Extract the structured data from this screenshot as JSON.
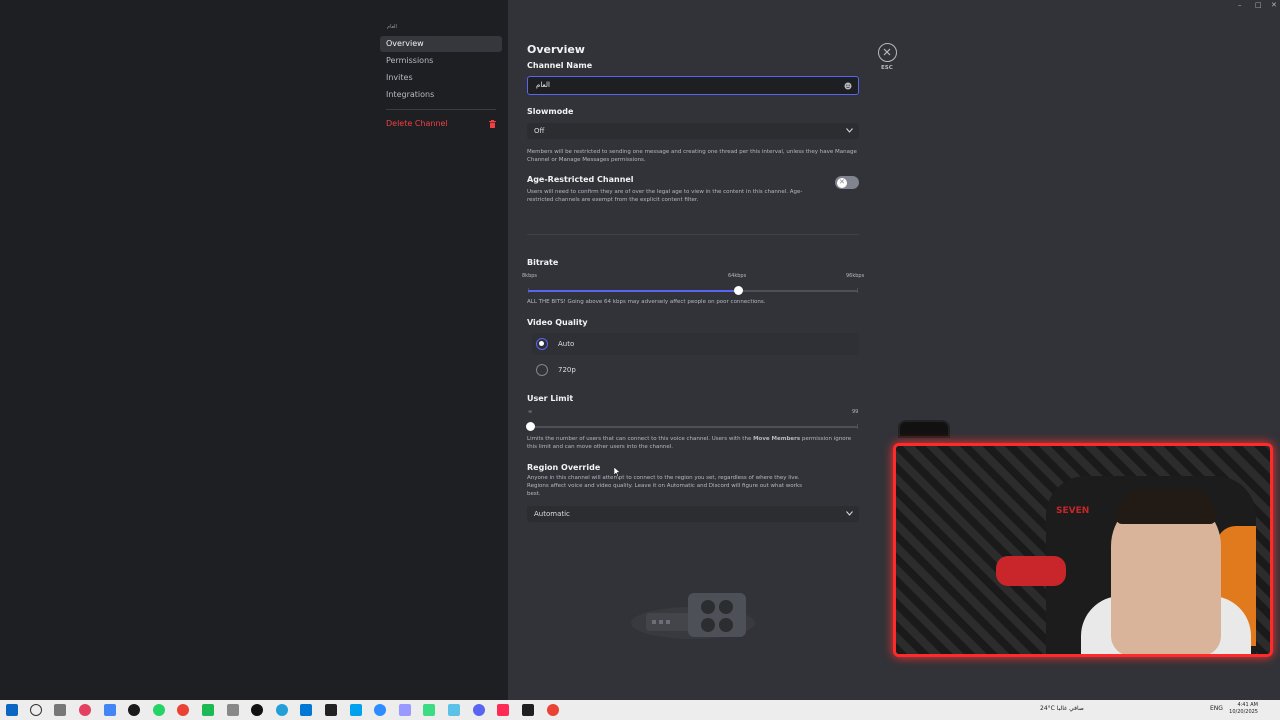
{
  "sidebar": {
    "header": "العام",
    "items": [
      {
        "label": "Overview",
        "active": true
      },
      {
        "label": "Permissions",
        "active": false
      },
      {
        "label": "Invites",
        "active": false
      },
      {
        "label": "Integrations",
        "active": false
      }
    ],
    "delete_label": "Delete Channel"
  },
  "overview": {
    "title": "Overview",
    "channel_name_label": "Channel Name",
    "channel_name_value": "العام",
    "slowmode_label": "Slowmode",
    "slowmode_value": "Off",
    "slowmode_hint": "Members will be restricted to sending one message and creating one thread per this interval, unless they have Manage Channel or Manage Messages permissions.",
    "age_label": "Age-Restricted Channel",
    "age_hint": "Users will need to confirm they are of over the legal age to view in the content in this channel. Age-restricted channels are exempt from the explicit content filter.",
    "age_enabled": false,
    "bitrate_label": "Bitrate",
    "bitrate_ticks": [
      "8kbps",
      "64kbps",
      "96kbps"
    ],
    "bitrate_value_kbps": 64,
    "bitrate_range_kbps": [
      8,
      96
    ],
    "bitrate_hint": "ALL THE BITS! Going above 64 kbps may adversely affect people on poor connections.",
    "video_quality_label": "Video Quality",
    "video_options": [
      {
        "label": "Auto",
        "selected": true
      },
      {
        "label": "720p",
        "selected": false
      }
    ],
    "user_limit_label": "User Limit",
    "user_limit_ticks": [
      "∞",
      "99"
    ],
    "user_limit_value": 0,
    "user_limit_hint_1": "Limits the number of users that can connect to this voice channel. Users with the ",
    "user_limit_hint_bold": "Move Members",
    "user_limit_hint_2": " permission ignore this limit and can move other users into the channel.",
    "region_label": "Region Override",
    "region_hint": "Anyone in this channel will attempt to connect to the region you set, regardless of where they live. Regions affect voice and video quality. Leave it on Automatic and Discord will figure out what works best.",
    "region_value": "Automatic",
    "esc_label": "ESC"
  },
  "webcam": {
    "logo_text": "SEVEN"
  },
  "taskbar": {
    "weather": "24°C صافي غالبا",
    "lang": "ENG",
    "time": "4:41 AM",
    "date": "10/20/2025"
  },
  "colors": {
    "accent": "#5865f2",
    "danger": "#f23f43",
    "cam_border": "#ff2a2a"
  }
}
